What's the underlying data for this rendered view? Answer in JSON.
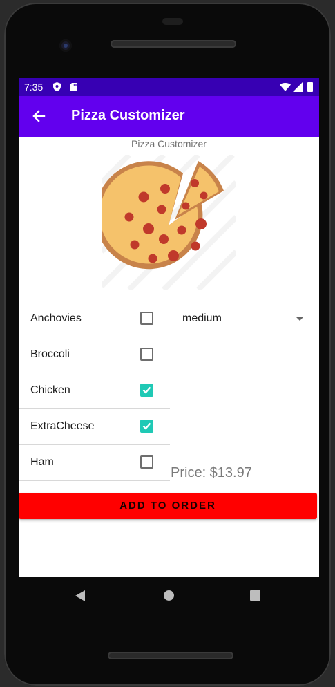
{
  "status_bar": {
    "time": "7:35",
    "icons": [
      "shield-icon",
      "sd-card-icon",
      "wifi-icon",
      "signal-icon",
      "battery-icon"
    ]
  },
  "app_bar": {
    "title": "Pizza Customizer",
    "back_icon": "arrow-back-icon",
    "color": "#6200ee",
    "status_color": "#3700b3"
  },
  "content": {
    "header": "Pizza Customizer",
    "image_icon": "pizza-icon",
    "toppings": [
      {
        "label": "Anchovies",
        "checked": false
      },
      {
        "label": "Broccoli",
        "checked": false
      },
      {
        "label": "Chicken",
        "checked": true
      },
      {
        "label": "ExtraCheese",
        "checked": true
      },
      {
        "label": "Ham",
        "checked": false
      }
    ],
    "size": {
      "selected": "medium",
      "icon": "dropdown-arrow-icon"
    },
    "price": "Price: $13.97",
    "order_button": "ADD TO ORDER",
    "accent": "#1fc9b5",
    "button_color": "#ff0000"
  },
  "nav_bar": {
    "icons": [
      "nav-back-icon",
      "nav-home-icon",
      "nav-recents-icon"
    ]
  }
}
